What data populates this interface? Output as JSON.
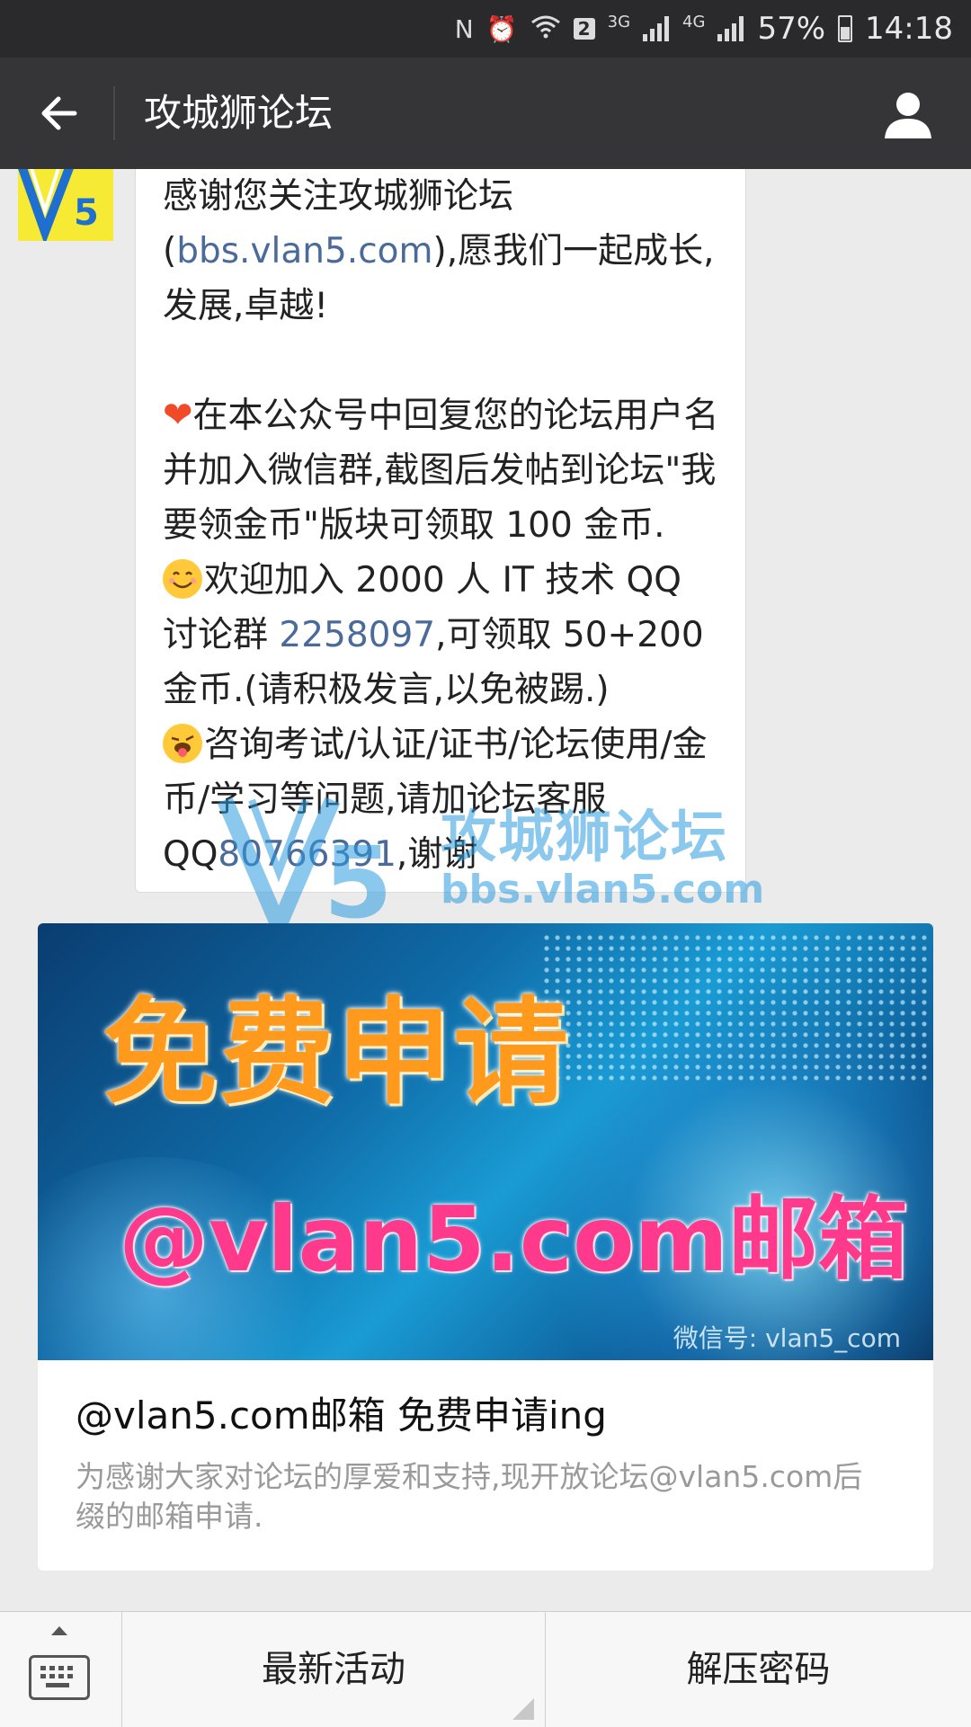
{
  "status_bar": {
    "nfc": "N",
    "sim_badge": "2",
    "net_3g": "3G",
    "net_4g": "4G",
    "battery": "57%",
    "time": "14:18"
  },
  "header": {
    "title": "攻城狮论坛",
    "back_icon": "arrow-left-icon",
    "profile_icon": "person-icon"
  },
  "message": {
    "p1_text": "感谢您关注攻城狮论坛(",
    "p1_link": "bbs.vlan5.com",
    "p1_rest": "),愿我们一起成长,发展,卓越!",
    "p2_text": "在本公众号中回复您的论坛用户名并加入微信群,截图后发帖到论坛\"我要领金币\"版块可领取 100 金币.",
    "p3_text": "欢迎加入 2000 人 IT 技术 QQ 讨论群 ",
    "p3_link": "2258097",
    "p3_rest": ",可领取 50+200 金币.(请积极发言,以免被踢.)",
    "p4_text": "咨询考试/认证/证书/论坛使用/金币/学习等问题,请加论坛客服 QQ",
    "p4_link": "80766391",
    "p4_rest": ",谢谢"
  },
  "watermark": {
    "title": "攻城狮论坛",
    "url": "bbs.vlan5.com"
  },
  "article": {
    "banner_line1": "免费申请",
    "banner_line2": "@vlan5.com邮箱",
    "banner_wechat": "微信号: vlan5_com",
    "title": "@vlan5.com邮箱  免费申请ing",
    "description": "为感谢大家对论坛的厚爱和支持,现开放论坛@vlan5.com后缀的邮箱申请."
  },
  "bottom_menu": {
    "keyboard_icon": "keyboard-icon",
    "item1": "最新活动",
    "item2": "解压密码"
  },
  "colors": {
    "navbar": "#353538",
    "link": "#4a6a9a",
    "banner_orange": "#ff9a1c",
    "banner_pink": "#ff3a8c"
  }
}
